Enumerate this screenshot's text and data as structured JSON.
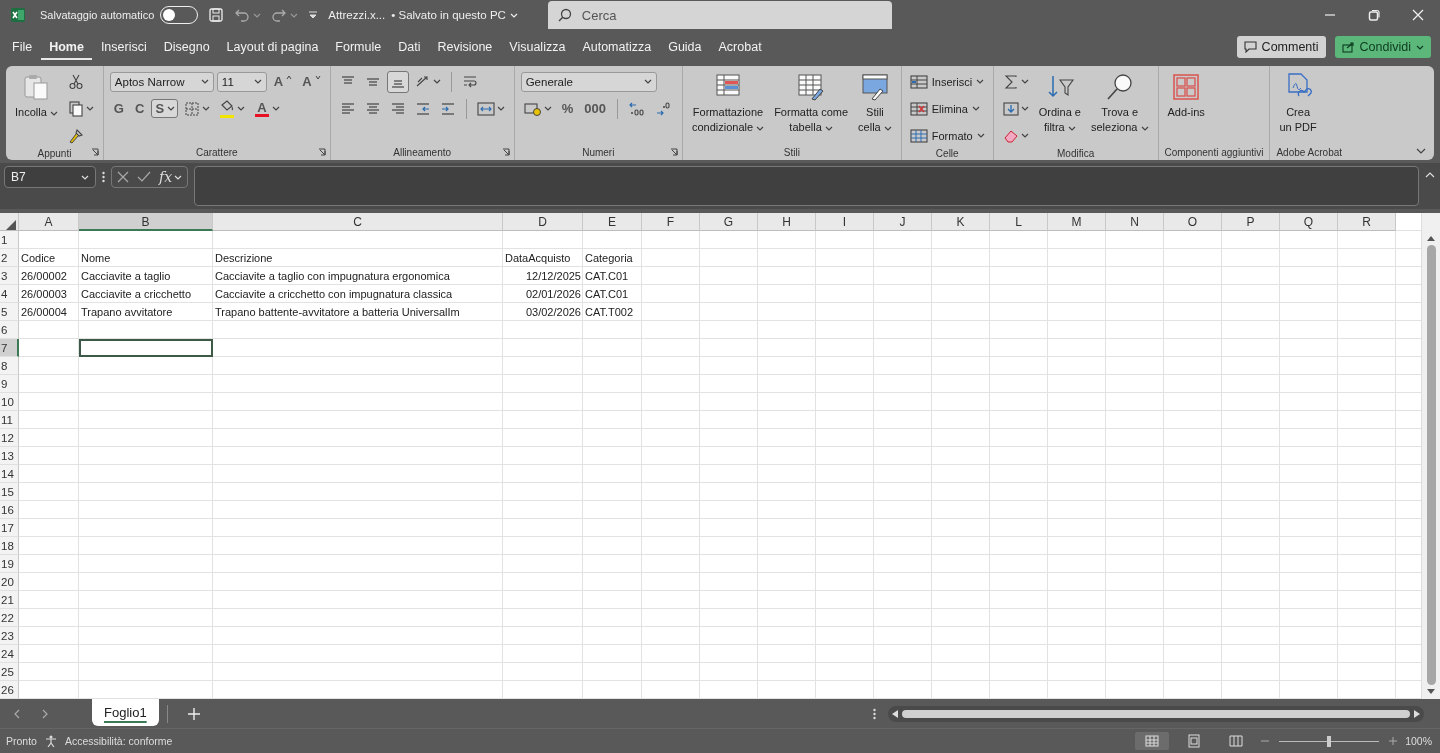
{
  "titlebar": {
    "autosave_label": "Salvataggio automatico",
    "autosave_on": false,
    "file_name": "Attrezzi.x...",
    "save_status": "• Salvato in questo PC",
    "search": {
      "placeholder": "Cerca"
    }
  },
  "tabs": [
    {
      "label": "File",
      "selected": false
    },
    {
      "label": "Home",
      "selected": true
    },
    {
      "label": "Inserisci",
      "selected": false
    },
    {
      "label": "Disegno",
      "selected": false
    },
    {
      "label": "Layout di pagina",
      "selected": false
    },
    {
      "label": "Formule",
      "selected": false
    },
    {
      "label": "Dati",
      "selected": false
    },
    {
      "label": "Revisione",
      "selected": false
    },
    {
      "label": "Visualizza",
      "selected": false
    },
    {
      "label": "Automatizza",
      "selected": false
    },
    {
      "label": "Guida",
      "selected": false
    },
    {
      "label": "Acrobat",
      "selected": false
    }
  ],
  "tab_actions": [
    {
      "label": "Commenti",
      "kind": "comments"
    },
    {
      "label": "Condividi",
      "kind": "share"
    }
  ],
  "ribbon": {
    "groups": [
      {
        "label": "Appunti",
        "launcher": true,
        "items": [
          {
            "kind": "large",
            "lines": [
              "Incolla"
            ],
            "caret": true
          },
          {
            "kind": "stack",
            "lines": [
              {
                "controls": [
                  {
                    "kind": "icon"
                  }
                ]
              },
              {
                "controls": [
                  {
                    "kind": "icon",
                    "caret": true
                  }
                ]
              },
              {
                "controls": [
                  {
                    "kind": "icon"
                  }
                ]
              }
            ]
          }
        ]
      },
      {
        "label": "Carattere",
        "launcher": true,
        "items": [
          {
            "kind": "stack",
            "lines": [
              {
                "controls": [
                  {
                    "kind": "combo",
                    "value": "Aptos Narrow"
                  },
                  {
                    "kind": "combo",
                    "value": "11"
                  },
                  {
                    "kind": "grow-font",
                    "text": "A"
                  },
                  {
                    "kind": "shrink-font",
                    "text": "A"
                  }
                ]
              },
              {
                "controls": [
                  {
                    "kind": "glyph",
                    "text": "G"
                  },
                  {
                    "kind": "glyph",
                    "text": "C"
                  },
                  {
                    "kind": "glyph",
                    "text": "S",
                    "caret": true,
                    "pressed": true
                  },
                  {
                    "kind": "icon",
                    "caret": true
                  },
                  {
                    "kind": "icon",
                    "caret": true,
                    "color": "#f2e600"
                  },
                  {
                    "kind": "glyph",
                    "text": "A",
                    "caret": true,
                    "color": "#e81123"
                  }
                ]
              }
            ]
          }
        ]
      },
      {
        "label": "Allineamento",
        "launcher": true,
        "items": [
          {
            "kind": "stack",
            "lines": [
              {
                "controls": [
                  {
                    "kind": "icon"
                  },
                  {
                    "kind": "icon"
                  },
                  {
                    "kind": "icon",
                    "pressed": true
                  },
                  {
                    "kind": "icon",
                    "caret": true
                  },
                  {
                    "kind": "sep"
                  },
                  {
                    "kind": "icon"
                  }
                ]
              },
              {
                "controls": [
                  {
                    "kind": "icon"
                  },
                  {
                    "kind": "icon"
                  },
                  {
                    "kind": "icon"
                  },
                  {
                    "kind": "icon"
                  },
                  {
                    "kind": "icon"
                  },
                  {
                    "kind": "sep"
                  },
                  {
                    "kind": "icon",
                    "caret": true
                  }
                ]
              }
            ]
          }
        ]
      },
      {
        "label": "Numeri",
        "launcher": true,
        "items": [
          {
            "kind": "stack",
            "lines": [
              {
                "controls": [
                  {
                    "kind": "combo",
                    "value": "Generale"
                  }
                ]
              },
              {
                "controls": [
                  {
                    "kind": "icon",
                    "caret": true
                  },
                  {
                    "kind": "glyph",
                    "text": "%"
                  },
                  {
                    "kind": "glyph",
                    "text": "000"
                  },
                  {
                    "kind": "sep"
                  },
                  {
                    "kind": "icon"
                  },
                  {
                    "kind": "icon"
                  }
                ]
              }
            ]
          }
        ]
      },
      {
        "label": "Stili",
        "launcher": false,
        "items": [
          {
            "kind": "large",
            "lines": [
              "Formattazione",
              "condizionale"
            ],
            "caret": true
          },
          {
            "kind": "large",
            "lines": [
              "Formatta come",
              "tabella"
            ],
            "caret": true
          },
          {
            "kind": "large",
            "lines": [
              "Stili",
              "cella"
            ],
            "caret": true
          }
        ]
      },
      {
        "label": "Celle",
        "launcher": false,
        "items": [
          {
            "kind": "stack",
            "lines": [
              {
                "controls": [
                  {
                    "kind": "small",
                    "label": "Inserisci",
                    "caret": true
                  }
                ]
              },
              {
                "controls": [
                  {
                    "kind": "small",
                    "label": "Elimina",
                    "caret": true
                  }
                ]
              },
              {
                "controls": [
                  {
                    "kind": "small",
                    "label": "Formato",
                    "caret": true
                  }
                ]
              }
            ]
          }
        ]
      },
      {
        "label": "Modifica",
        "launcher": false,
        "items": [
          {
            "kind": "stack",
            "lines": [
              {
                "controls": [
                  {
                    "kind": "icon",
                    "caret": true
                  }
                ]
              },
              {
                "controls": [
                  {
                    "kind": "icon",
                    "caret": true
                  }
                ]
              },
              {
                "controls": [
                  {
                    "kind": "icon",
                    "caret": true
                  }
                ]
              }
            ]
          },
          {
            "kind": "large",
            "lines": [
              "Ordina e",
              "filtra"
            ],
            "caret": true
          },
          {
            "kind": "large",
            "lines": [
              "Trova e",
              "seleziona"
            ],
            "caret": true
          }
        ]
      },
      {
        "label": "Componenti aggiuntivi",
        "launcher": false,
        "items": [
          {
            "kind": "large",
            "lines": [
              "Add-ins"
            ]
          }
        ]
      },
      {
        "label": "Adobe Acrobat",
        "launcher": false,
        "items": [
          {
            "kind": "large",
            "lines": [
              "Crea",
              "un PDF"
            ]
          }
        ]
      }
    ]
  },
  "formula_bar": {
    "name_box": "B7",
    "function_label": "fx"
  },
  "sheet": {
    "columns": [
      {
        "label": "A",
        "selected": false
      },
      {
        "label": "B",
        "selected": true
      },
      {
        "label": "C",
        "selected": false
      },
      {
        "label": "D",
        "selected": false
      },
      {
        "label": "E",
        "selected": false
      },
      {
        "label": "F",
        "selected": false
      },
      {
        "label": "G",
        "selected": false
      },
      {
        "label": "H",
        "selected": false
      },
      {
        "label": "I",
        "selected": false
      },
      {
        "label": "J",
        "selected": false
      },
      {
        "label": "K",
        "selected": false
      },
      {
        "label": "L",
        "selected": false
      },
      {
        "label": "M",
        "selected": false
      },
      {
        "label": "N",
        "selected": false
      },
      {
        "label": "O",
        "selected": false
      },
      {
        "label": "P",
        "selected": false
      },
      {
        "label": "Q",
        "selected": false
      },
      {
        "label": "R",
        "selected": false
      }
    ],
    "rows": [
      {
        "label": "1",
        "selected": false
      },
      {
        "label": "2",
        "selected": false,
        "cells": [
          {
            "text": "Codice",
            "kind": "text"
          },
          {
            "text": "Nome",
            "kind": "text"
          },
          {
            "text": "Descrizione",
            "kind": "text"
          },
          {
            "text": "DataAcquisto",
            "kind": "text"
          },
          {
            "text": "Categoria",
            "kind": "text"
          }
        ]
      },
      {
        "label": "3",
        "selected": false,
        "cells": [
          {
            "text": "26/00002",
            "kind": "text"
          },
          {
            "text": "Cacciavite a taglio",
            "kind": "text"
          },
          {
            "text": "Cacciavite a taglio con impugnatura ergonomica",
            "kind": "text"
          },
          {
            "text": "12/12/2025",
            "kind": "date"
          },
          {
            "text": "CAT.C01",
            "kind": "text"
          }
        ]
      },
      {
        "label": "4",
        "selected": false,
        "cells": [
          {
            "text": "26/00003",
            "kind": "text"
          },
          {
            "text": "Cacciavite a cricchetto",
            "kind": "text"
          },
          {
            "text": "Cacciavite a cricchetto con impugnatura classica",
            "kind": "text"
          },
          {
            "text": "02/01/2026",
            "kind": "date"
          },
          {
            "text": "CAT.C01",
            "kind": "text"
          }
        ]
      },
      {
        "label": "5",
        "selected": false,
        "cells": [
          {
            "text": "26/00004",
            "kind": "text"
          },
          {
            "text": "Trapano avvitatore",
            "kind": "text"
          },
          {
            "text": "Trapano battente-avvitatore a batteria UniversalIm",
            "kind": "text"
          },
          {
            "text": "03/02/2026",
            "kind": "date"
          },
          {
            "text": "CAT.T002",
            "kind": "text"
          }
        ]
      },
      {
        "label": "6",
        "selected": false
      },
      {
        "label": "7",
        "selected": true
      },
      {
        "label": "8",
        "selected": false
      },
      {
        "label": "9",
        "selected": false
      },
      {
        "label": "10",
        "selected": false
      },
      {
        "label": "11",
        "selected": false
      },
      {
        "label": "12",
        "selected": false
      },
      {
        "label": "13",
        "selected": false
      },
      {
        "label": "14",
        "selected": false
      },
      {
        "label": "15",
        "selected": false
      },
      {
        "label": "16",
        "selected": false
      },
      {
        "label": "17",
        "selected": false
      },
      {
        "label": "18",
        "selected": false
      },
      {
        "label": "19",
        "selected": false
      },
      {
        "label": "20",
        "selected": false
      },
      {
        "label": "21",
        "selected": false
      },
      {
        "label": "22",
        "selected": false
      },
      {
        "label": "23",
        "selected": false
      },
      {
        "label": "24",
        "selected": false
      },
      {
        "label": "25",
        "selected": false
      },
      {
        "label": "26",
        "selected": false
      }
    ]
  },
  "sheet_tabs": [
    {
      "label": "Foglio1",
      "selected": true
    }
  ],
  "status_bar": {
    "state": "Pronto",
    "accessibility": "Accessibilità: conforme",
    "views": [
      {
        "selected": true
      },
      {
        "selected": false
      },
      {
        "selected": false
      }
    ],
    "zoom": {
      "level": 0.5,
      "reading": "100%"
    }
  }
}
